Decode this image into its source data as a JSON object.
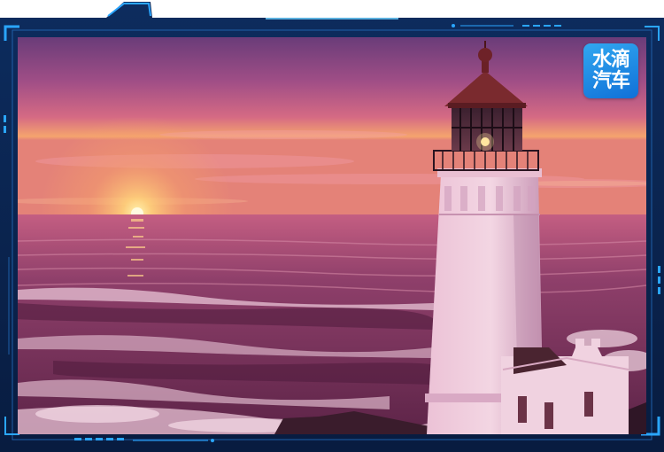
{
  "watermark": {
    "line1": "水滴",
    "line2": "汽车",
    "color": "#1f86e6"
  },
  "scene": {
    "subject": "lighthouse-at-sunset",
    "colors": {
      "sky_top": "#6d3f78",
      "sky_mid": "#d0677e",
      "horizon": "#f6a06a",
      "sea": "#8a3c5e",
      "frame": "#0b2550",
      "frame_accent": "#2aa6ff"
    }
  }
}
